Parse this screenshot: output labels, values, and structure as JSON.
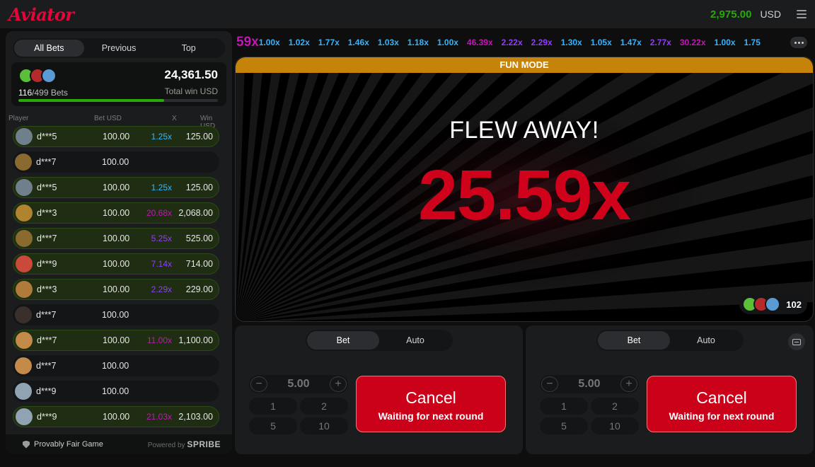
{
  "header": {
    "logo": "Aviator",
    "balance": "2,975.00",
    "currency": "USD"
  },
  "left_panel": {
    "tabs": [
      "All Bets",
      "Previous",
      "Top"
    ],
    "active_tab": 0,
    "bets_count": "116",
    "bets_total": "/499 Bets",
    "total_win": "24,361.50",
    "total_win_label": "Total win USD",
    "progress_fraction": 0.73,
    "columns": {
      "player": "Player",
      "bet": "Bet USD",
      "x": "X",
      "win": "Win USD"
    },
    "rows": [
      {
        "player": "d***5",
        "bet": "100.00",
        "mult": "1.25x",
        "win": "125.00",
        "won": true,
        "mult_color": "#34b4ff",
        "avatar": "#6f7f8c"
      },
      {
        "player": "d***7",
        "bet": "100.00",
        "mult": "",
        "win": "",
        "won": false,
        "mult_color": "",
        "avatar": "#8a6a2f"
      },
      {
        "player": "d***5",
        "bet": "100.00",
        "mult": "1.25x",
        "win": "125.00",
        "won": true,
        "mult_color": "#34b4ff",
        "avatar": "#6f7f8c"
      },
      {
        "player": "d***3",
        "bet": "100.00",
        "mult": "20.68x",
        "win": "2,068.00",
        "won": true,
        "mult_color": "#c017b4",
        "avatar": "#b0832f"
      },
      {
        "player": "d***7",
        "bet": "100.00",
        "mult": "5.25x",
        "win": "525.00",
        "won": true,
        "mult_color": "#913ef8",
        "avatar": "#8a6a2f"
      },
      {
        "player": "d***9",
        "bet": "100.00",
        "mult": "7.14x",
        "win": "714.00",
        "won": true,
        "mult_color": "#913ef8",
        "avatar": "#c94a3a"
      },
      {
        "player": "d***3",
        "bet": "100.00",
        "mult": "2.29x",
        "win": "229.00",
        "won": true,
        "mult_color": "#913ef8",
        "avatar": "#b07a3a"
      },
      {
        "player": "d***7",
        "bet": "100.00",
        "mult": "",
        "win": "",
        "won": false,
        "mult_color": "",
        "avatar": "#3a2f2a"
      },
      {
        "player": "d***7",
        "bet": "100.00",
        "mult": "11.00x",
        "win": "1,100.00",
        "won": true,
        "mult_color": "#c017b4",
        "avatar": "#c48a4a"
      },
      {
        "player": "d***7",
        "bet": "100.00",
        "mult": "",
        "win": "",
        "won": false,
        "mult_color": "",
        "avatar": "#c48a4a"
      },
      {
        "player": "d***9",
        "bet": "100.00",
        "mult": "",
        "win": "",
        "won": false,
        "mult_color": "",
        "avatar": "#8fa3b3"
      },
      {
        "player": "d***9",
        "bet": "100.00",
        "mult": "21.03x",
        "win": "2,103.00",
        "won": true,
        "mult_color": "#c017b4",
        "avatar": "#8fa3b3"
      }
    ],
    "footer": {
      "provably_fair": "Provably Fair Game",
      "powered_by": "Powered by",
      "brand": "SPRIBE"
    }
  },
  "history": [
    {
      "value": "59x",
      "color": "#c017b4"
    },
    {
      "value": "1.00x",
      "color": "#34b4ff"
    },
    {
      "value": "1.02x",
      "color": "#34b4ff"
    },
    {
      "value": "1.77x",
      "color": "#34b4ff"
    },
    {
      "value": "1.46x",
      "color": "#34b4ff"
    },
    {
      "value": "1.03x",
      "color": "#34b4ff"
    },
    {
      "value": "1.18x",
      "color": "#34b4ff"
    },
    {
      "value": "1.00x",
      "color": "#34b4ff"
    },
    {
      "value": "46.39x",
      "color": "#c017b4"
    },
    {
      "value": "2.22x",
      "color": "#913ef8"
    },
    {
      "value": "2.29x",
      "color": "#913ef8"
    },
    {
      "value": "1.30x",
      "color": "#34b4ff"
    },
    {
      "value": "1.05x",
      "color": "#34b4ff"
    },
    {
      "value": "1.47x",
      "color": "#34b4ff"
    },
    {
      "value": "2.77x",
      "color": "#913ef8"
    },
    {
      "value": "30.22x",
      "color": "#c017b4"
    },
    {
      "value": "1.00x",
      "color": "#34b4ff"
    },
    {
      "value": "1.75",
      "color": "#34b4ff"
    }
  ],
  "game": {
    "banner": "FUN MODE",
    "status": "FLEW AWAY!",
    "multiplier": "25.59x",
    "players_count": "102"
  },
  "bet_panels": [
    {
      "tabs": [
        "Bet",
        "Auto"
      ],
      "amount": "5.00",
      "quick": [
        "1",
        "2",
        "5",
        "10"
      ],
      "cancel_label": "Cancel",
      "cancel_sub": "Waiting for next round"
    },
    {
      "tabs": [
        "Bet",
        "Auto"
      ],
      "amount": "5.00",
      "quick": [
        "1",
        "2",
        "5",
        "10"
      ],
      "cancel_label": "Cancel",
      "cancel_sub": "Waiting for next round"
    }
  ],
  "colors": {
    "accent_red": "#e50539",
    "balance_green": "#28a909",
    "banner_orange": "#c6830a",
    "cancel_red": "#cb011a"
  }
}
